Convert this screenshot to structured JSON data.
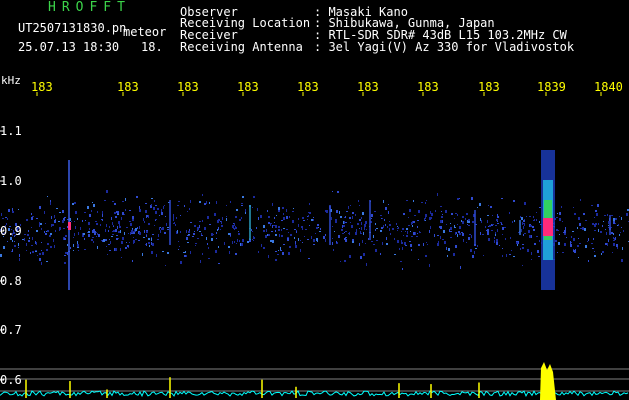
{
  "header": {
    "brand": "HROFFT",
    "filename": "UT2507131830.pn",
    "meteor_label": "meteor",
    "datetime": "25.07.13 18:30",
    "meteor_count": "18.",
    "info": [
      {
        "label": "Observer",
        "value": ": Masaki Kano"
      },
      {
        "label": "Receiving Location",
        "value": ": Shibukawa, Gunma, Japan"
      },
      {
        "label": "Receiver",
        "value": ": RTL-SDR SDR# 43dB L15 103.2MHz CW"
      },
      {
        "label": "Receiving Antenna",
        "value": ": 3el Yagi(V) Az 330 for Vladivostok"
      }
    ]
  },
  "axes": {
    "y_unit": "kHz",
    "x_ticks": [
      "183",
      "183",
      "183",
      "183",
      "183",
      "183",
      "183",
      "183",
      "1839",
      "1840"
    ],
    "y_ticks": [
      "1.1",
      "1.0",
      "0.9",
      "0.8",
      "0.7",
      "0.6"
    ]
  },
  "colors": {
    "brand": "#3cd44a",
    "text": "#ffffff",
    "ticks": "#ffff00",
    "axis_text": "#ffffff",
    "trace": "#00ffff",
    "peak": "#ffff00",
    "grid": "#808080"
  }
}
